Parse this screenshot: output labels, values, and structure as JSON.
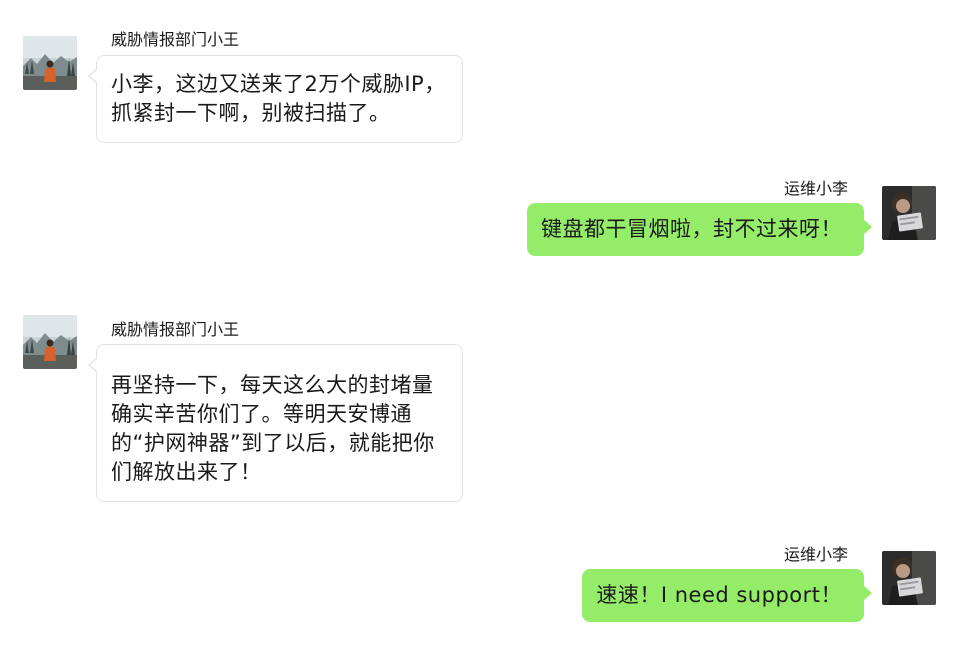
{
  "colors": {
    "outgoing_bubble": "#95ec69",
    "incoming_bubble": "#ffffff",
    "incoming_border": "#e3e3e3",
    "text": "#1a1a1a"
  },
  "messages": [
    {
      "direction": "incoming",
      "sender": "威胁情报部门小王",
      "avatar": "landscape-avatar-icon",
      "text": "小李，这边又送来了2万个威胁IP，抓紧封一下啊，别被扫描了。"
    },
    {
      "direction": "outgoing",
      "sender": "运维小李",
      "avatar": "person-photo-avatar-icon",
      "text": "键盘都干冒烟啦，封不过来呀！"
    },
    {
      "direction": "incoming",
      "sender": "威胁情报部门小王",
      "avatar": "landscape-avatar-icon",
      "text": "再坚持一下，每天这么大的封堵量确实辛苦你们了。等明天安博通的“护网神器”到了以后，就能把你们解放出来了！"
    },
    {
      "direction": "outgoing",
      "sender": "运维小李",
      "avatar": "person-photo-avatar-icon",
      "text": "速速！I need support！"
    }
  ]
}
